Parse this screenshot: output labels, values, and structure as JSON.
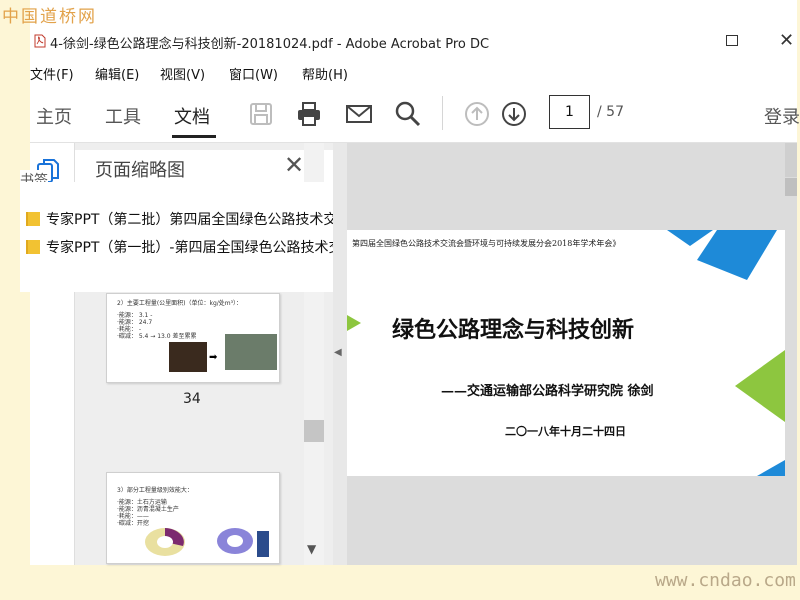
{
  "watermark": {
    "top": "中国道桥网",
    "bottom": "www.cndao.com"
  },
  "window": {
    "title": "4-徐剑-绿色公路理念与科技创新-20181024.pdf - Adobe Acrobat Pro DC"
  },
  "menu": [
    "文件(F)",
    "编辑(E)",
    "视图(V)",
    "窗口(W)",
    "帮助(H)"
  ],
  "toolbar": {
    "tabs": [
      "主页",
      "工具",
      "文档"
    ],
    "active_tab": "文档",
    "tools": [
      "save-icon",
      "print-icon",
      "mail-icon",
      "search-icon",
      "page-up-icon",
      "page-down-icon"
    ],
    "page_current": "1",
    "page_total": "/ 57",
    "signin": "登录"
  },
  "left_panel": {
    "title": "页面缩略图",
    "bookmark_label": "书签",
    "bookmarks": [
      "专家PPT（第二批）第四届全国绿色公路技术交流会",
      "专家PPT（第一批）-第四届全国绿色公路技术交流会"
    ],
    "thumbnails": [
      {
        "number": "34",
        "lines": [
          "2）主要工程量(公里面积)（单位：kg/处m³）：",
          "·能源：  3.1 -",
          "·能源：  24.7",
          "·耗能：  -",
          "·碳减：  5.4  → 13.0 差至累累"
        ]
      },
      {
        "number": "",
        "lines": [
          "3）部分工程量级别效能大：",
          "·能源：土石方运输",
          "·能源：沥青混凝土生产",
          "·耗能：——",
          "·碳减：开挖"
        ]
      }
    ]
  },
  "slide": {
    "header": "第四届全国绿色公路技术交流会暨环境与可持续发展分会2018年学术年会》",
    "title": "绿色公路理念与科技创新",
    "author": "——交通运输部公路科学研究院  徐剑",
    "date": "二〇一八年十月二十四日",
    "colors": {
      "blue": "#1e8ad8",
      "green": "#8dc63f"
    }
  }
}
